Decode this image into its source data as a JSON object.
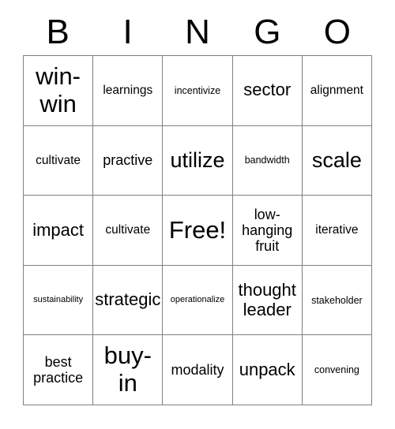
{
  "header": {
    "letters": [
      "B",
      "I",
      "N",
      "G",
      "O"
    ]
  },
  "grid": {
    "rows": [
      [
        {
          "text": "win-\nwin",
          "size": "fs-huge"
        },
        {
          "text": "learnings",
          "size": "fs-m"
        },
        {
          "text": "incentivize",
          "size": "fs-s"
        },
        {
          "text": "sector",
          "size": "fs-xl"
        },
        {
          "text": "alignment",
          "size": "fs-m"
        }
      ],
      [
        {
          "text": "cultivate",
          "size": "fs-m"
        },
        {
          "text": "practive",
          "size": "fs-l"
        },
        {
          "text": "utilize",
          "size": "fs-xxl"
        },
        {
          "text": "bandwidth",
          "size": "fs-s"
        },
        {
          "text": "scale",
          "size": "fs-xxl"
        }
      ],
      [
        {
          "text": "impact",
          "size": "fs-xl"
        },
        {
          "text": "cultivate",
          "size": "fs-m"
        },
        {
          "text": "Free!",
          "size": "fs-huge"
        },
        {
          "text": "low-\nhanging\nfruit",
          "size": "fs-l"
        },
        {
          "text": "iterative",
          "size": "fs-m"
        }
      ],
      [
        {
          "text": "sustainability",
          "size": "fs-xs"
        },
        {
          "text": "strategic",
          "size": "fs-xl"
        },
        {
          "text": "operationalize",
          "size": "fs-xs"
        },
        {
          "text": "thought\nleader",
          "size": "fs-xl"
        },
        {
          "text": "stakeholder",
          "size": "fs-s"
        }
      ],
      [
        {
          "text": "best\npractice",
          "size": "fs-l"
        },
        {
          "text": "buy-\nin",
          "size": "fs-huge"
        },
        {
          "text": "modality",
          "size": "fs-l"
        },
        {
          "text": "unpack",
          "size": "fs-xl"
        },
        {
          "text": "convening",
          "size": "fs-s"
        }
      ]
    ]
  },
  "colors": {
    "border": "#808080",
    "background": "#ffffff",
    "text": "#000000"
  }
}
